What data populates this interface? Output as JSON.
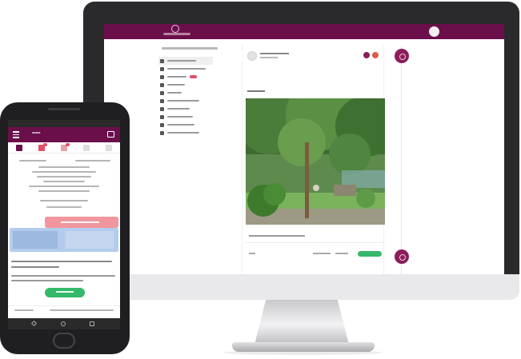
{
  "desktop": {
    "topbar": {
      "logo": "app-logo",
      "avatar_icon": "user-avatar-icon"
    },
    "nav_items": [
      {
        "icon": "home-icon",
        "active": true,
        "has_badge": false
      },
      {
        "icon": "people-icon",
        "active": false,
        "has_badge": false
      },
      {
        "icon": "message-icon",
        "active": false,
        "has_badge": true
      },
      {
        "icon": "calendar-icon",
        "active": false,
        "has_badge": false
      },
      {
        "icon": "bell-icon",
        "active": false,
        "has_badge": false
      },
      {
        "icon": "group-icon",
        "active": false,
        "has_badge": false
      },
      {
        "icon": "document-icon",
        "active": false,
        "has_badge": false
      },
      {
        "icon": "book-icon",
        "active": false,
        "has_badge": false
      },
      {
        "icon": "link-icon",
        "active": false,
        "has_badge": false
      },
      {
        "icon": "settings-icon",
        "active": false,
        "has_badge": false
      }
    ],
    "post_actions_color": "#35b86a",
    "brand_color": "#6a0f4a",
    "accent_color": "#8b1d5b"
  },
  "phone": {
    "header": {
      "title": "•••••",
      "menu_icon": "hamburger-icon",
      "action_icon": "compose-icon"
    },
    "tabs": [
      {
        "icon": "home-icon",
        "color": "#6a0f4a"
      },
      {
        "icon": "flag-icon",
        "color": "#e0506a"
      },
      {
        "icon": "chat-icon",
        "color": "#e0506a"
      },
      {
        "icon": "bell-icon",
        "color": "#cccccc"
      },
      {
        "icon": "calendar-icon",
        "color": "#cccccc"
      }
    ],
    "alert_color": "#f0969e",
    "info_color": "#b4ccec",
    "button_color": "#35b86a"
  }
}
